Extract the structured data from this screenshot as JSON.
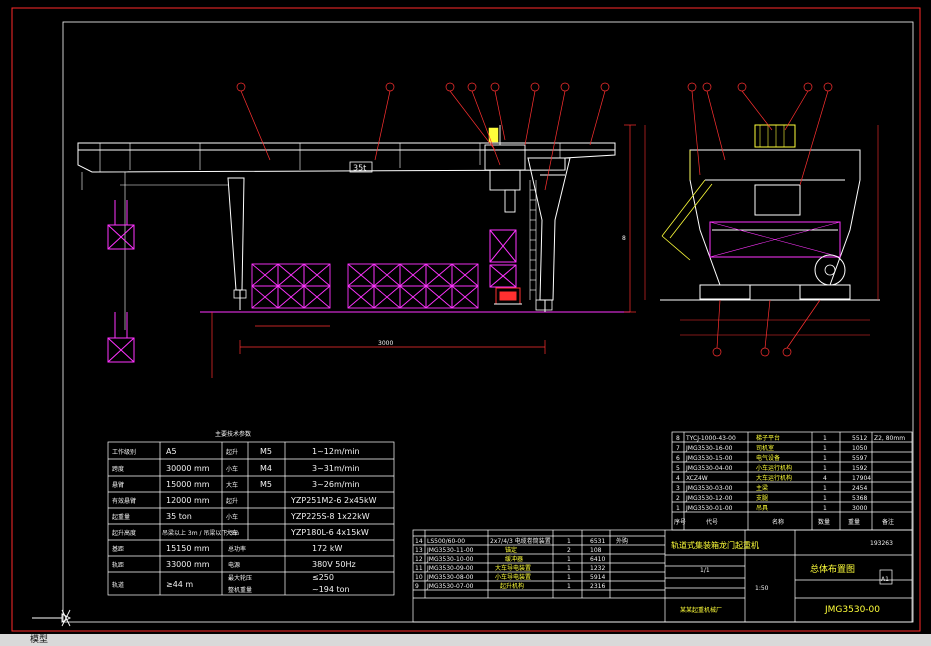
{
  "colors": {
    "background": "#000000",
    "frame": "#ff2a2a",
    "structure": "#ffffff",
    "callout": "#ff3030",
    "hoist": "#ff33ff",
    "equipment": "#ff00ff",
    "dimension": "#ff3030",
    "rail": "#ff33ff",
    "accent": "#ffff3a"
  },
  "drawing": {
    "girder_tag": "35t",
    "dim_left": "3000",
    "dim_height": "8"
  },
  "params": {
    "title": "主要技术参数",
    "left_rows": [
      {
        "label": "工作级别",
        "value": "A5"
      },
      {
        "label": "跨度",
        "value": "30000 mm"
      },
      {
        "label": "悬臂",
        "value": "15000 mm"
      },
      {
        "label": "有效悬臂",
        "value": "12000 mm"
      },
      {
        "label": "起重量",
        "value": "35 ton"
      },
      {
        "label": "起升高度",
        "value": "吊梁以上 3m / 吊梁以下 3m"
      },
      {
        "label": "基距",
        "value": "15150 mm"
      },
      {
        "label": "轨距",
        "value": "33000 mm"
      },
      {
        "label": "轨道",
        "value": "≥44 m"
      }
    ],
    "speed_rows": [
      {
        "mech": "起升",
        "grade": "M5",
        "value": "1~12m/min"
      },
      {
        "mech": "小车",
        "grade": "M4",
        "value": "3~31m/min"
      },
      {
        "mech": "大车",
        "grade": "M5",
        "value": "3~26m/min"
      }
    ],
    "motor_rows": [
      {
        "mech": "起升",
        "value": "YZP251M2-6  2x45kW"
      },
      {
        "mech": "小车",
        "value": "YZP225S-8  1x22kW"
      },
      {
        "mech": "大车",
        "value": "YZP180L-6  4x15kW"
      }
    ],
    "power_rows": [
      {
        "label": "总功率",
        "value": "172 kW"
      },
      {
        "label": "电源",
        "value": "380V 50Hz"
      },
      {
        "label": "最大轮压",
        "value": "≤250"
      },
      {
        "label": "整机重量",
        "value": "~194 ton"
      }
    ]
  },
  "bom_right": {
    "rows": [
      {
        "no": "8",
        "code": "TYCJ-1000-43-00",
        "name": "梯子平台",
        "qty": "1",
        "weight": "5512",
        "note": "Z2, 80mm"
      },
      {
        "no": "7",
        "code": "JMG3530-16-00",
        "name": "司机室",
        "qty": "1",
        "weight": "1050",
        "note": ""
      },
      {
        "no": "6",
        "code": "JMG3530-15-00",
        "name": "电气设备",
        "qty": "1",
        "weight": "5597",
        "note": ""
      },
      {
        "no": "5",
        "code": "JMG3530-04-00",
        "name": "小车运行机构",
        "qty": "1",
        "weight": "1592",
        "note": ""
      },
      {
        "no": "4",
        "code": "XCZ4W",
        "name": "大车运行机构",
        "qty": "4",
        "weight": "17904",
        "note": ""
      },
      {
        "no": "3",
        "code": "JMG3530-03-00",
        "name": "主梁",
        "qty": "1",
        "weight": "2454",
        "note": ""
      },
      {
        "no": "2",
        "code": "JMG3530-12-00",
        "name": "支腿",
        "qty": "1",
        "weight": "5368",
        "note": ""
      },
      {
        "no": "1",
        "code": "JMG3530-01-00",
        "name": "吊具",
        "qty": "1",
        "weight": "3000",
        "note": ""
      }
    ],
    "header": [
      "序号",
      "代号",
      "名称",
      "数量",
      "重量",
      "备注"
    ]
  },
  "bom_left": {
    "rows": [
      {
        "no": "14",
        "code": "LS500/60-00",
        "name": "2x7/4/3 电缆卷筒装置",
        "qty": "1",
        "weight": "6531",
        "note": "外购"
      },
      {
        "no": "13",
        "code": "JMG3530-11-00",
        "name": "锚定",
        "qty": "2",
        "weight": "108",
        "note": ""
      },
      {
        "no": "12",
        "code": "JMG3530-10-00",
        "name": "缓冲器",
        "qty": "1",
        "weight": "6410",
        "note": ""
      },
      {
        "no": "11",
        "code": "JMG3530-09-00",
        "name": "大车导电装置",
        "qty": "1",
        "weight": "1232",
        "note": ""
      },
      {
        "no": "10",
        "code": "JMG3530-08-00",
        "name": "小车导电装置",
        "qty": "1",
        "weight": "5914",
        "note": ""
      },
      {
        "no": "9",
        "code": "JMG3530-07-00",
        "name": "起升机构",
        "qty": "1",
        "weight": "2316",
        "note": ""
      }
    ]
  },
  "title_block": {
    "drawing_name": "轨道式集装箱龙门起重机",
    "sub_name": "总体布置图",
    "company": "某某起重机械厂",
    "drawing_no": "JMG3530-00",
    "total_weight": "193263",
    "sheet": "A1",
    "scale": "1:50",
    "sheet_count": "1/1"
  },
  "status": {
    "label": "模型"
  }
}
